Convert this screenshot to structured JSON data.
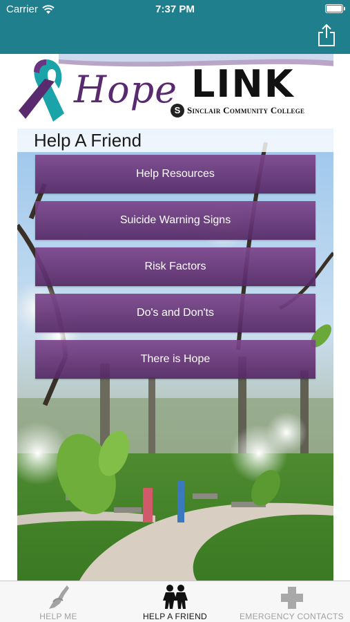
{
  "status_bar": {
    "carrier": "Carrier",
    "time": "7:37 PM"
  },
  "nav_bar": {
    "share_icon": "share-icon",
    "color": "#1f7f8c"
  },
  "banner": {
    "hope": "Hope",
    "link": "LINK",
    "college_logo_letter": "S",
    "college": "Sinclair Community College"
  },
  "page": {
    "title": "Help A Friend"
  },
  "menu": [
    {
      "label": "Help Resources"
    },
    {
      "label": "Suicide Warning Signs"
    },
    {
      "label": "Risk Factors"
    },
    {
      "label": "Do's and Don'ts"
    },
    {
      "label": "There is Hope"
    }
  ],
  "tabs": [
    {
      "label": "HELP ME",
      "icon": "helping-hand-icon",
      "active": false
    },
    {
      "label": "HELP A FRIEND",
      "icon": "two-people-icon",
      "active": true
    },
    {
      "label": "EMERGENCY CONTACTS",
      "icon": "medical-cross-icon",
      "active": false
    }
  ],
  "colors": {
    "accent": "#1f7f8c",
    "button": "#6a3580",
    "brand_purple": "#5a2a6e",
    "ribbon_teal": "#1aa3a8"
  }
}
